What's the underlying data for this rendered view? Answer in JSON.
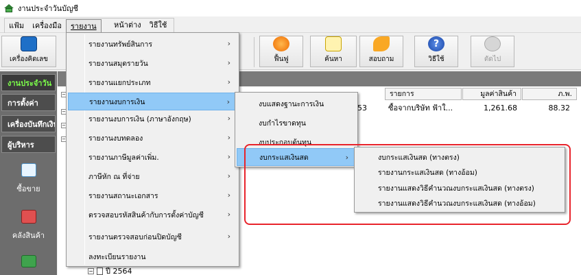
{
  "window": {
    "title": "งานประจำวันบัญชี"
  },
  "menubar": {
    "items": [
      "แฟ้ม",
      "เครื่องมือ",
      "รายงาน",
      "หน้าต่าง",
      "วิธีใช้"
    ]
  },
  "toolbar": {
    "buttons": [
      {
        "label": "เครื่องคิดเลข",
        "icon": "calculator-icon",
        "enabled": true
      },
      {
        "label": "ฟื้นฟู",
        "icon": "refresh-icon",
        "enabled": true
      },
      {
        "label": "ค้นหา",
        "icon": "search-icon",
        "enabled": true
      },
      {
        "label": "สอบถาม",
        "icon": "phone-icon",
        "enabled": true
      },
      {
        "label": "วิธีใช้",
        "icon": "help-icon",
        "enabled": true
      },
      {
        "label": "ตัดไป",
        "icon": "next-icon",
        "enabled": false
      }
    ]
  },
  "sidebar": {
    "tabs": [
      "งานประจำวัน",
      "การตั้งค่า",
      "เครื่องบันทึกเงิน",
      "ผู้บริหาร"
    ],
    "active_tab": "งานประจำวัน",
    "buttons": [
      {
        "label": "ซื้อขาย",
        "icon": "buy-sell-icon"
      },
      {
        "label": "คลังสินค้า",
        "icon": "warehouse-icon"
      },
      {
        "label": "",
        "icon": "money-icon"
      }
    ]
  },
  "grid": {
    "headers": [
      "รายการ",
      "มูลค่าสินค้า",
      "ภ.พ."
    ],
    "row": {
      "code_suffix": "53",
      "description": "ซื้อจากบริษัท ฟ้าใ...",
      "value": "1,261.68",
      "vat": "88.32"
    }
  },
  "tree": {
    "year_label": "ปี 2564"
  },
  "report_menu": {
    "items": [
      {
        "label": "รายงานทรัพย์สินการ",
        "submenu": true
      },
      {
        "label": "รายงานสมุดรายวัน",
        "submenu": true
      },
      {
        "label": "รายงานแยกประเภท",
        "submenu": true
      },
      {
        "label": "รายงานงบการเงิน",
        "submenu": true,
        "highlighted": true
      },
      {
        "label": "รายงานงบการเงิน (ภาษาอังกฤษ)",
        "submenu": true
      },
      {
        "label": "รายงานงบทดลอง",
        "submenu": true
      },
      {
        "label": "รายงานภาษีมูลค่าเพิ่ม.",
        "submenu": true
      },
      {
        "label": "ภาษีหัก ณ ที่จ่าย",
        "submenu": true
      },
      {
        "label": "รายงานสถานะเอกสาร",
        "submenu": true
      },
      {
        "label": "ตรวจสอบรหัสสินค้ากับการตั้งค่าบัญชี",
        "submenu": true
      },
      {
        "label": "รายงานตรวจสอบก่อนปิดบัญชี",
        "submenu": true
      },
      {
        "label": "ลงทะเบียนรายงาน",
        "submenu": false
      }
    ]
  },
  "financial_menu": {
    "items": [
      {
        "label": "งบแสดงฐานะการเงิน",
        "submenu": false
      },
      {
        "label": "งบกำไรขาดทุน",
        "submenu": false
      },
      {
        "label": "งบประกอบต้นทุน",
        "submenu": false
      },
      {
        "label": "งบกระแสเงินสด",
        "submenu": true,
        "highlighted": true
      }
    ]
  },
  "cashflow_menu": {
    "items": [
      {
        "label": "งบกระแสเงินสด (ทางตรง)"
      },
      {
        "label": "รายงานกระแสเงินสด (ทางอ้อม)"
      },
      {
        "label": "รายงานแสดงวิธีคำนวณงบกระแสเงินสด (ทางตรง)"
      },
      {
        "label": "รายงานแสดงวิธีคำนวณงบกระแสเงินสด (ทางอ้อม)"
      }
    ]
  },
  "colors": {
    "highlight": "#91c9f7",
    "annotation": "#e8222a",
    "active_tab_text": "#7cff4a"
  }
}
